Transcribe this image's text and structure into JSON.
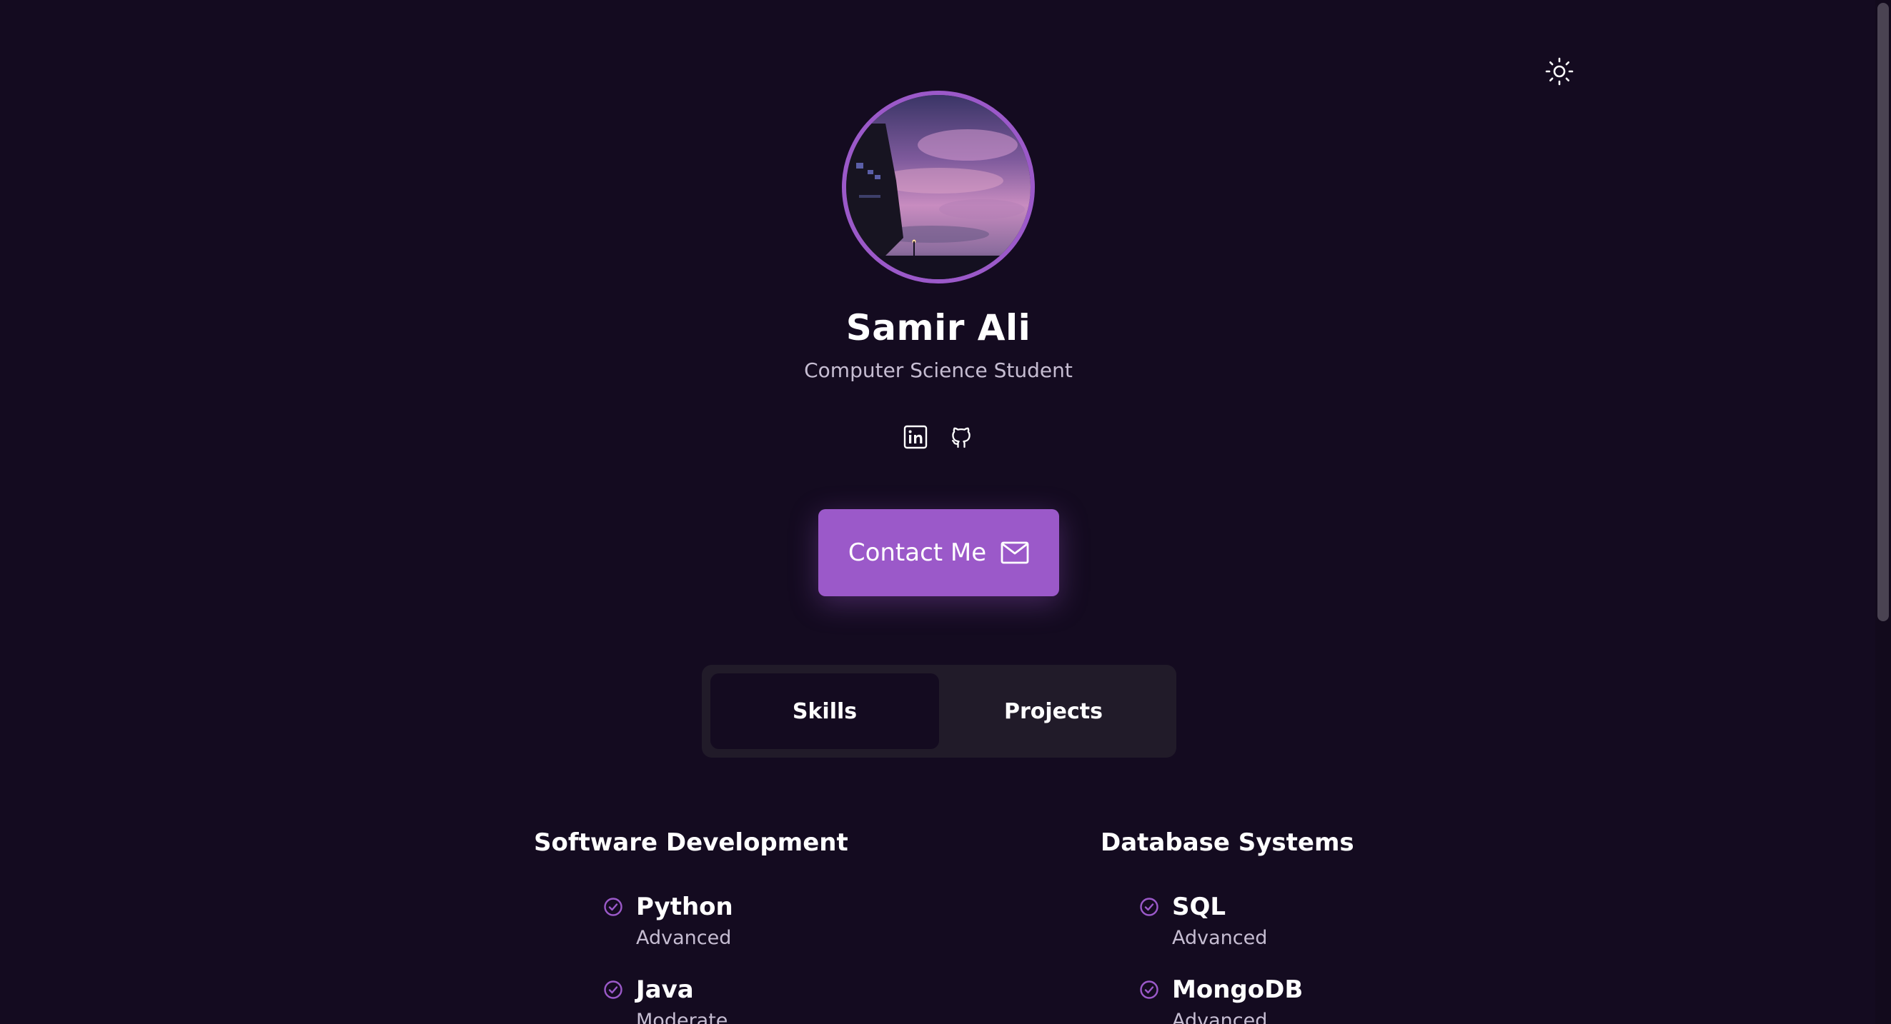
{
  "profile": {
    "name": "Samir Ali",
    "title": "Computer Science Student"
  },
  "socials": [
    {
      "icon": "linkedin-icon"
    },
    {
      "icon": "github-icon"
    }
  ],
  "contact_button": {
    "label": "Contact Me",
    "icon": "mail-icon"
  },
  "tabs": [
    {
      "label": "Skills",
      "active": true
    },
    {
      "label": "Projects",
      "active": false
    }
  ],
  "skills": {
    "software": {
      "title": "Software Development",
      "items": [
        {
          "name": "Python",
          "level": "Advanced"
        },
        {
          "name": "Java",
          "level": "Moderate"
        }
      ]
    },
    "database": {
      "title": "Database Systems",
      "items": [
        {
          "name": "SQL",
          "level": "Advanced"
        },
        {
          "name": "MongoDB",
          "level": "Advanced"
        }
      ]
    }
  },
  "colors": {
    "background": "#140b20",
    "accent": "#9b59c9",
    "tab_bar": "#211b29",
    "muted_text": "#c6bdd2"
  },
  "theme_toggle_icon": "sun-icon"
}
